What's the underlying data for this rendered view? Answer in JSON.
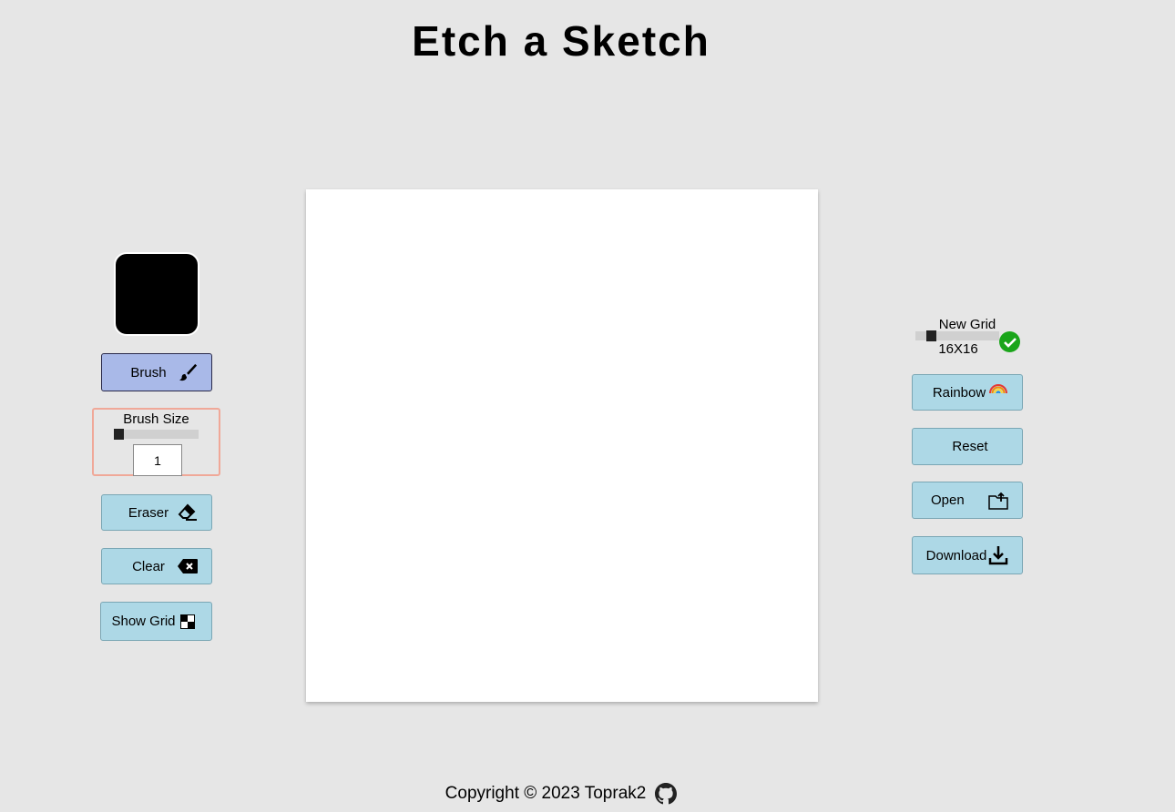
{
  "header": {
    "title": "Etch a Sketch"
  },
  "left_panel": {
    "current_color": "#000000",
    "brush": {
      "label": "Brush",
      "icon": "paintbrush-icon",
      "active": true
    },
    "brush_size": {
      "label": "Brush Size",
      "value": "1",
      "slider_value": 1
    },
    "eraser": {
      "label": "Eraser",
      "icon": "eraser-icon"
    },
    "clear": {
      "label": "Clear",
      "icon": "backspace-icon"
    },
    "show_grid": {
      "label": "Show Grid",
      "icon": "grid-icon"
    }
  },
  "canvas": {
    "background": "#ffffff"
  },
  "right_panel": {
    "new_grid": {
      "label": "New Grid",
      "size_text": "16X16",
      "confirm_icon": "check-circle-icon"
    },
    "rainbow": {
      "label": "Rainbow",
      "icon": "rainbow-icon"
    },
    "reset": {
      "label": "Reset"
    },
    "open": {
      "label": "Open",
      "icon": "folder-upload-icon"
    },
    "download": {
      "label": "Download",
      "icon": "download-icon"
    }
  },
  "footer": {
    "text": "Copyright © 2023 Toprak2",
    "icon": "github-icon"
  },
  "colors": {
    "background": "#e6e6e6",
    "button": "#add8e6",
    "button_active": "#a9b9e8",
    "confirm": "#1aa51a"
  }
}
